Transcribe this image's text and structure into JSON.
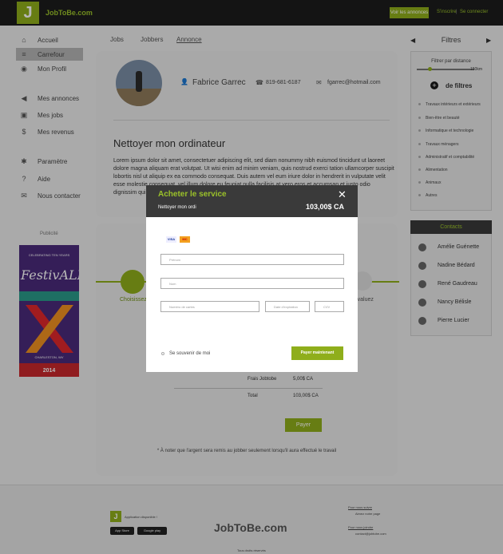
{
  "header": {
    "logo_letter": "J",
    "brand": "JobToBe.com",
    "view_ads_button": "Voir les annonces",
    "signup_link": "S'inscrire",
    "login_link": "Se connecter"
  },
  "sidebar": {
    "items": [
      {
        "label": "Accueil",
        "icon": "home-icon"
      },
      {
        "label": "Carrefour",
        "icon": "list-icon",
        "active": true
      },
      {
        "label": "Mon Profil",
        "icon": "profile-icon"
      },
      {
        "label": "Mes annonces",
        "icon": "megaphone-icon"
      },
      {
        "label": "Mes jobs",
        "icon": "briefcase-icon"
      },
      {
        "label": "Mes revenus",
        "icon": "money-icon"
      },
      {
        "label": "Paramètre",
        "icon": "gear-icon"
      },
      {
        "label": "Aide",
        "icon": "help-icon"
      },
      {
        "label": "Nous contacter",
        "icon": "envelope-icon"
      }
    ],
    "ad_label": "Publicité",
    "ad": {
      "top_text": "CELEBRATING TEN YEARS",
      "title": "FestivALL",
      "foot_text": "CHARLESTON, WV",
      "year": "2014"
    }
  },
  "tabs": [
    "Jobs",
    "Jobbers",
    "Annonce"
  ],
  "profile": {
    "name": "Fabrice Garrec",
    "phone": "819-681-6187",
    "email": "fgarrec@hotmail.com"
  },
  "job": {
    "title": "Nettoyer mon ordinateur",
    "description": "Lorem ipsum dolor sit amet, consectetuer adipiscing elit, sed diam nonummy nibh euismod tincidunt ut laoreet dolore magna aliquam erat volutpat. Ut wisi enim ad minim veniam, quis nostrud exerci tation ullamcorper suscipit lobortis nisl ut aliquip ex ea commodo consequat. Duis autem vel eum iriure dolor in hendrerit in vulputate velit esse molestie consequat, vel illum dolore eu feugiat nulla facilisis at vero eros et accumsan et iusto odio dignissim qui blandit praesent luptatum zzril delenit augue duis dolore te feugait nulla facilisi.",
    "desc_tail": "Lorem ipsum"
  },
  "steps": {
    "step1": "Choisissez",
    "step_last": "Évaluez"
  },
  "summary": {
    "fee_label": "Frais Jobtobe",
    "fee_value": "5,00$ CA",
    "total_label": "Total",
    "total_value": "103,00$ CA",
    "pay_button": "Payer",
    "note": "* À noter que l'argent sera remis au jobber seulement lorsqu'il aura effectué le travail"
  },
  "filters": {
    "title": "Filtres",
    "distance_label": "Filtrer par distance",
    "distance_value": "150km",
    "add_label": "de filtres",
    "categories": [
      "Travaux intérieurs et extérieurs",
      "Bien-être et beauté",
      "Informatique et technologie",
      "Travaux ménagers",
      "Administratif et comptabilité",
      "Alimentation",
      "Animaux",
      "Autres"
    ]
  },
  "contacts": {
    "title": "Contacts",
    "people": [
      "Amélie Guénette",
      "Nadine Bédard",
      "René Gaudreau",
      "Nancy Bélisle",
      "Pierre Lucier"
    ]
  },
  "footer": {
    "logo_letter": "J",
    "app_text": "Application disponible !",
    "app_store": "App Store",
    "google_play": "Google play",
    "brand": "JobToBe.com",
    "follow_title": "Pour nous suivre",
    "follow_text": "Aimez notre page",
    "join_title": "Pour nous joindre",
    "join_text": "contact@jobtobe.com",
    "copyright": "Tous droits réservés"
  },
  "modal": {
    "title": "Acheter le service",
    "subtitle": "Nettoyer mon ordi",
    "price": "103,00$ CA",
    "visa": "VISA",
    "mastercard": "MC",
    "first_name_placeholder": "Prénom",
    "last_name_placeholder": "Nom",
    "card_number_placeholder": "Numéro de cartes",
    "expiry_placeholder": "Date d'expiration",
    "cvv_placeholder": "CVV",
    "remember_label": "Se souvenir de moi",
    "pay_now_button": "Payer maintenant"
  },
  "colors": {
    "accent": "#8fae1b",
    "accent_text": "#9bc22a",
    "dark": "#1c1c1c"
  }
}
